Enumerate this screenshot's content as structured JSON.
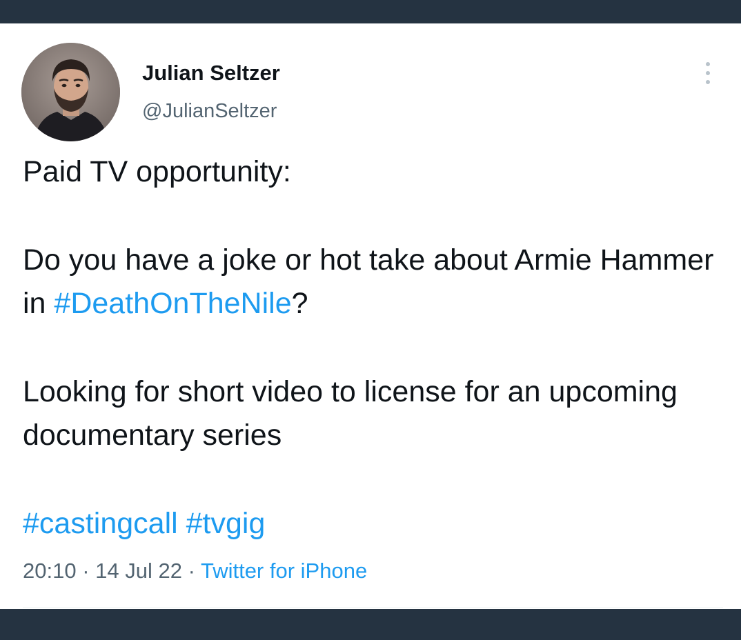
{
  "tweet": {
    "author": {
      "display_name": "Julian Seltzer",
      "handle": "@JulianSeltzer",
      "avatar_icon": "profile-photo"
    },
    "more_icon": "more-vertical-icon",
    "text": {
      "line1": "Paid TV opportunity:",
      "para2_prefix": "Do you have a joke or hot take about Armie Hammer in ",
      "para2_hashtag": "#DeathOnTheNile",
      "para2_suffix": "?",
      "para3": "Looking for short video to license for an upcoming documentary series",
      "hashtag1": "#castingcall",
      "hashtag2": "#tvgig"
    },
    "meta": {
      "time": "20:10",
      "separator1": " · ",
      "date": "14 Jul 22",
      "separator2": " · ",
      "source": "Twitter for iPhone"
    }
  },
  "colors": {
    "link": "#1d9bf0",
    "text": "#0f1419",
    "secondary": "#536471",
    "frame": "#253341"
  }
}
